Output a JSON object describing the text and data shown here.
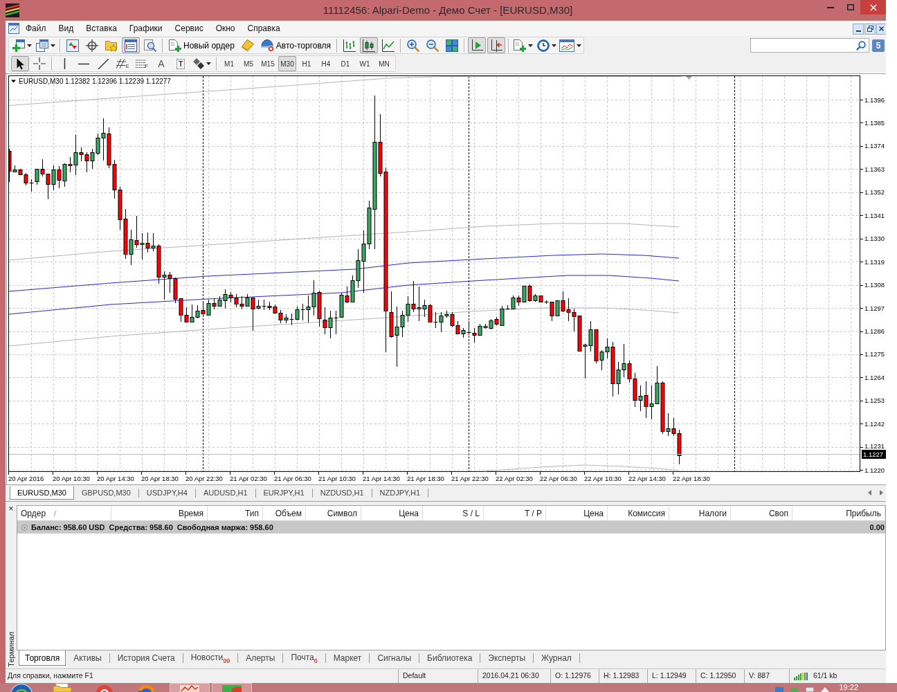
{
  "window": {
    "title": "11112456: Alpari-Demo - Демо Счет - [EURUSD,M30]"
  },
  "menu": [
    "Файл",
    "Вид",
    "Вставка",
    "Графики",
    "Сервис",
    "Окно",
    "Справка"
  ],
  "toolbar": [
    [
      {
        "kind": "new-chart",
        "pressed": false
      },
      {
        "kind": "profiles",
        "pressed": false
      }
    ],
    [
      {
        "kind": "market-watch",
        "pressed": false
      },
      {
        "kind": "navigator",
        "pressed": false
      },
      {
        "kind": "favorites",
        "pressed": false
      },
      {
        "kind": "terminal",
        "pressed": true
      },
      {
        "kind": "tester",
        "pressed": false
      }
    ],
    [
      {
        "kind": "new-order",
        "label": "Новый ордер",
        "pressed": false
      },
      {
        "kind": "editor",
        "pressed": false
      },
      {
        "kind": "auto-trading",
        "label": "Авто-торговля",
        "pressed": false
      }
    ],
    [
      {
        "kind": "bar-chart",
        "pressed": false
      },
      {
        "kind": "candle-chart",
        "pressed": true
      },
      {
        "kind": "line-chart",
        "pressed": false
      }
    ],
    [
      {
        "kind": "zoom-in",
        "pressed": false
      },
      {
        "kind": "zoom-out",
        "pressed": false
      },
      {
        "kind": "tile",
        "pressed": false
      }
    ],
    [
      {
        "kind": "auto-scroll",
        "pressed": true
      },
      {
        "kind": "chart-shift",
        "pressed": true
      }
    ],
    [
      {
        "kind": "indicators",
        "pressed": false
      },
      {
        "kind": "periods",
        "pressed": false
      },
      {
        "kind": "templates",
        "pressed": false
      }
    ]
  ],
  "messages": {
    "count": "5"
  },
  "drawing_tools": [
    [
      {
        "kind": "cursor",
        "pressed": true
      },
      {
        "kind": "crosshair",
        "pressed": false
      }
    ],
    [
      {
        "kind": "vertical-line",
        "pressed": false
      },
      {
        "kind": "horizontal-line",
        "pressed": false
      },
      {
        "kind": "trend-line",
        "pressed": false
      },
      {
        "kind": "channel",
        "letter": "E",
        "pressed": false
      },
      {
        "kind": "fibonacci",
        "letter": "F",
        "pressed": false
      },
      {
        "kind": "text",
        "glyph": "A",
        "pressed": false
      },
      {
        "kind": "text-label",
        "glyph": "T",
        "pressed": false
      },
      {
        "kind": "shapes",
        "pressed": false
      }
    ]
  ],
  "timeframes": [
    {
      "label": "M1",
      "selected": false
    },
    {
      "label": "M5",
      "selected": false
    },
    {
      "label": "M15",
      "selected": false
    },
    {
      "label": "M30",
      "selected": true
    },
    {
      "label": "H1",
      "selected": false
    },
    {
      "label": "H4",
      "selected": false
    },
    {
      "label": "D1",
      "selected": false
    },
    {
      "label": "W1",
      "selected": false
    },
    {
      "label": "MN",
      "selected": false
    }
  ],
  "chart": {
    "symbol": "EURUSD,M30",
    "ohlc": "1.12382 1.12396 1.12239 1.12277",
    "price_labels": [
      "1.1396",
      "1.1385",
      "1.1374",
      "1.1363",
      "1.1352",
      "1.1341",
      "1.1330",
      "1.1319",
      "1.1308",
      "1.1297",
      "1.1286",
      "1.1275",
      "1.1264",
      "1.1253",
      "1.1242",
      "1.1231",
      "1.1220"
    ],
    "current_price": "1.1227",
    "time_labels": [
      "20 Apr 2016",
      "20 Apr 10:30",
      "20 Apr 14:30",
      "20 Apr 18:30",
      "20 Apr 22:30",
      "21 Apr 02:30",
      "21 Apr 06:30",
      "21 Apr 10:30",
      "21 Apr 14:30",
      "21 Apr 18:30",
      "21 Apr 22:30",
      "22 Apr 02:30",
      "22 Apr 06:30",
      "22 Apr 10:30",
      "22 Apr 14:30",
      "22 Apr 18:30"
    ]
  },
  "chart_tabs": [
    {
      "label": "EURUSD,M30",
      "selected": true
    },
    {
      "label": "GBPUSD,M30",
      "selected": false
    },
    {
      "label": "USDJPY,H4",
      "selected": false
    },
    {
      "label": "AUDUSD,H1",
      "selected": false
    },
    {
      "label": "EURJPY,H1",
      "selected": false
    },
    {
      "label": "NZDUSD,H1",
      "selected": false
    },
    {
      "label": "NZDJPY,H1",
      "selected": false
    }
  ],
  "terminal": {
    "title": "Терминал",
    "close": "×",
    "columns": [
      {
        "label": "Ордер",
        "sort_mark": "/"
      },
      {
        "label": "Время"
      },
      {
        "label": "Тип"
      },
      {
        "label": "Объем"
      },
      {
        "label": "Символ"
      },
      {
        "label": "Цена"
      },
      {
        "label": "S / L"
      },
      {
        "label": "T / P"
      },
      {
        "label": "Цена"
      },
      {
        "label": "Комиссия"
      },
      {
        "label": "Налоги"
      },
      {
        "label": "Своп"
      },
      {
        "label": "Прибыль"
      }
    ],
    "summary": {
      "items": [
        "Баланс: 958.60 USD",
        "Средства: 958.60",
        "Свободная маржа: 958.60"
      ],
      "profit": "0.00"
    },
    "tabs": [
      {
        "label": "Торговля",
        "selected": true
      },
      {
        "label": "Активы",
        "selected": false
      },
      {
        "label": "История Счета",
        "selected": false
      },
      {
        "label": "Новости",
        "badge": "99",
        "selected": false
      },
      {
        "label": "Алерты",
        "selected": false
      },
      {
        "label": "Почта",
        "badge": "6",
        "selected": false
      },
      {
        "label": "Маркет",
        "selected": false
      },
      {
        "label": "Сигналы",
        "selected": false
      },
      {
        "label": "Библиотека",
        "selected": false
      },
      {
        "label": "Эксперты",
        "selected": false
      },
      {
        "label": "Журнал",
        "selected": false
      }
    ]
  },
  "status_bar": {
    "help": "Для справки, нажмите F1",
    "profile": "Default",
    "time": "2016.04.21 06:30",
    "open": "O: 1.12976",
    "high": "H: 1.12983",
    "low": "L: 1.12949",
    "close": "C: 1.12950",
    "volume": "V: 887",
    "traffic": "61/1 kb"
  },
  "taskbar": {
    "clock": "19:22"
  }
}
